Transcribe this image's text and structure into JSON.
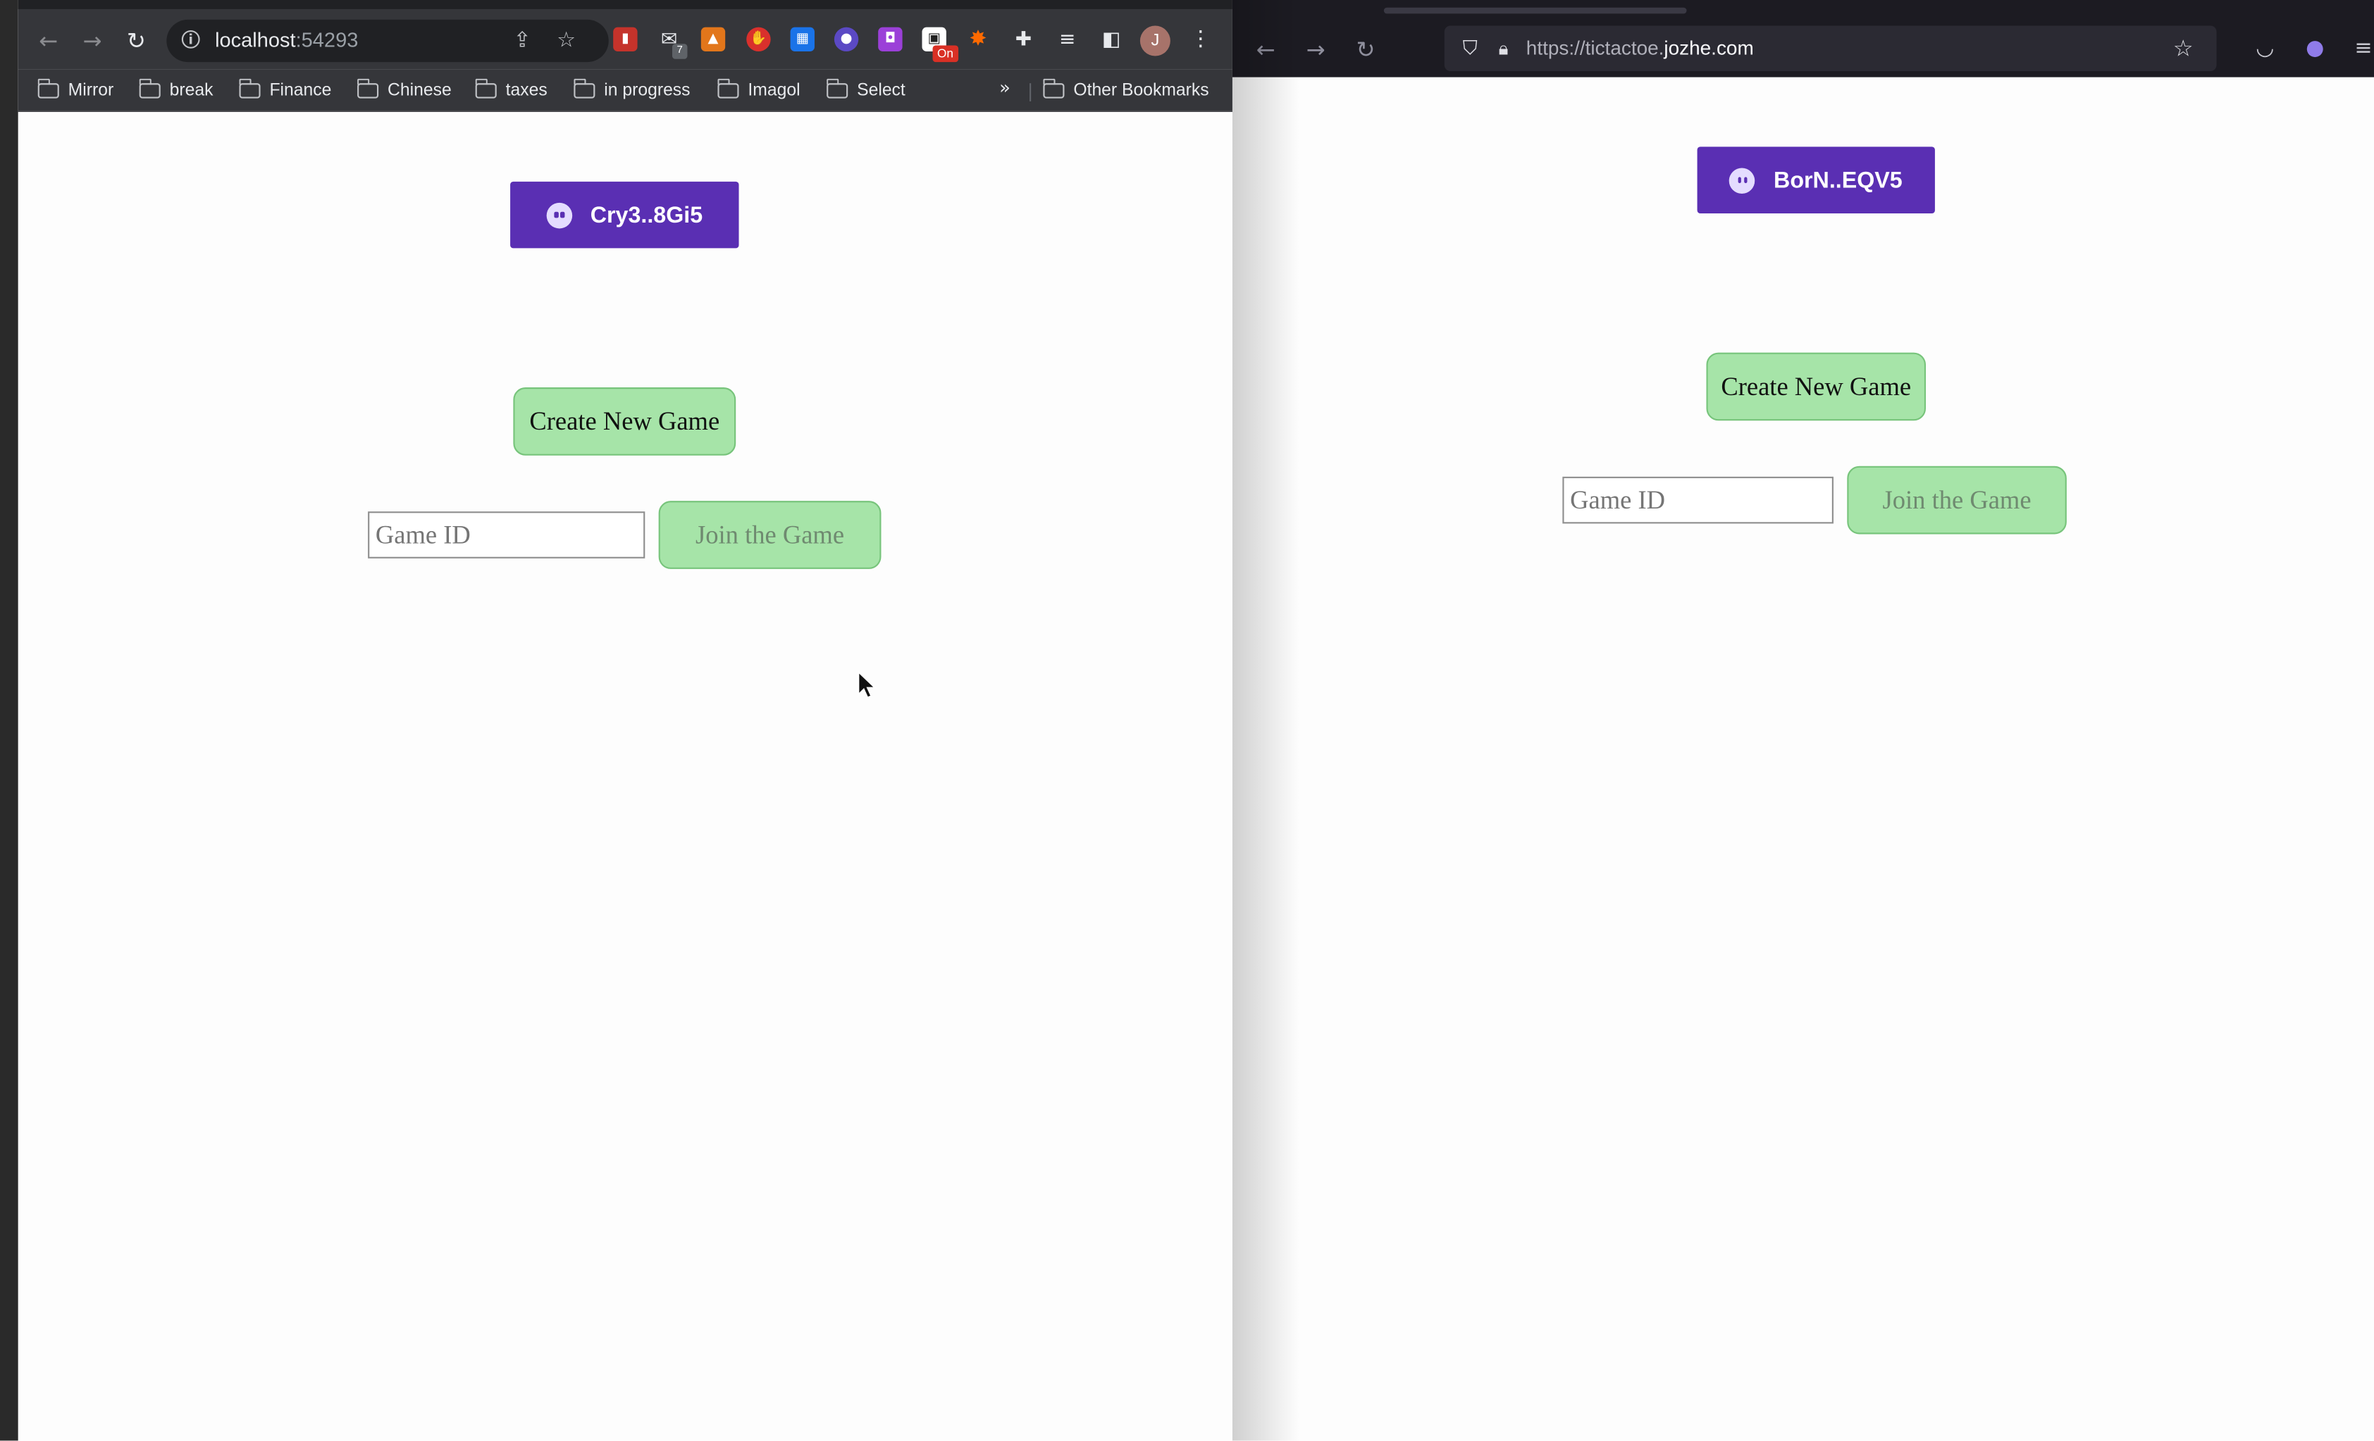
{
  "chrome": {
    "url_host": "localhost",
    "url_port": ":54293",
    "avatar_initial": "J",
    "extension_badge": "On",
    "mail_badge": "7",
    "bookmarks": [
      {
        "label": "Mirror"
      },
      {
        "label": "break"
      },
      {
        "label": "Finance"
      },
      {
        "label": "Chinese"
      },
      {
        "label": "taxes"
      },
      {
        "label": "in progress"
      },
      {
        "label": "Imagol"
      },
      {
        "label": "Select"
      }
    ],
    "overflow_chevron": "»",
    "other_bookmarks": "Other Bookmarks",
    "app": {
      "wallet_label": "Cry3..8Gi5",
      "create_label": "Create New Game",
      "game_id_placeholder": "Game ID",
      "join_label": "Join the Game"
    }
  },
  "firefox": {
    "url_scheme": "https://tictactoe.",
    "url_host": "jozhe.com",
    "app": {
      "wallet_label": "BorN..EQV5",
      "create_label": "Create New Game",
      "game_id_placeholder": "Game ID",
      "join_label": "Join the Game"
    }
  },
  "colors": {
    "wallet_purple": "#5a2fb3",
    "button_green": "#a6e4a8",
    "chrome_toolbar": "#35363a",
    "firefox_toolbar": "#1c1b22"
  },
  "icons": {
    "back": "arrow-left-icon",
    "forward": "arrow-right-icon",
    "reload": "reload-icon",
    "bookmark_star": "star-icon",
    "share": "share-icon",
    "extensions": "puzzle-icon",
    "wallet": "phantom-ghost-icon"
  }
}
